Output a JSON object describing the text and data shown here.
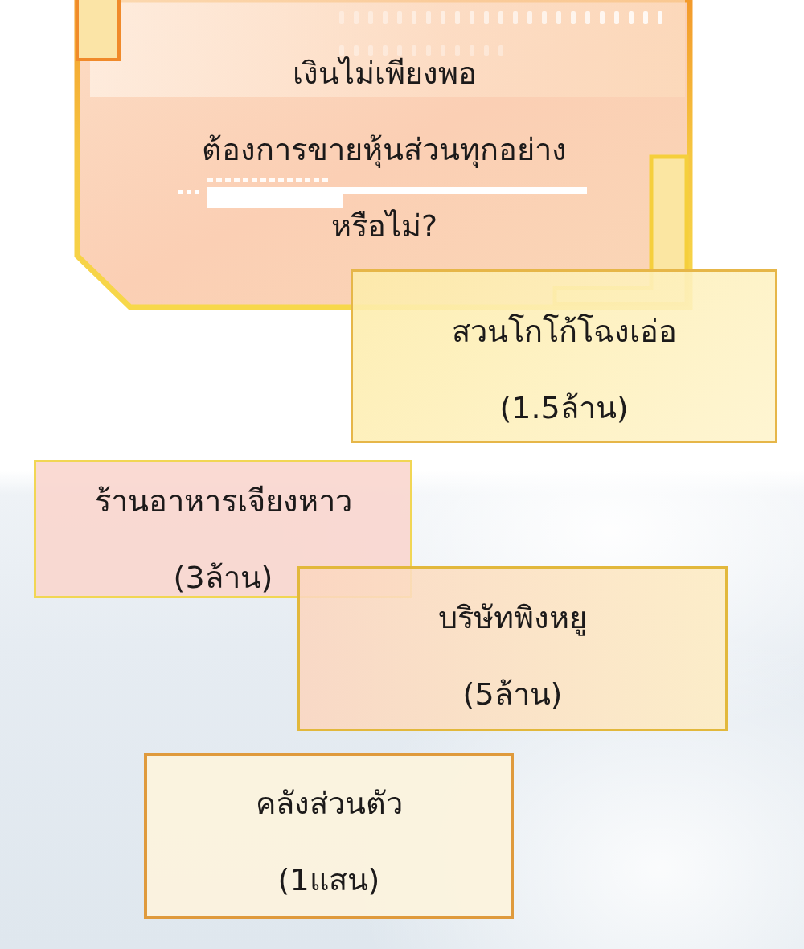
{
  "dialog": {
    "lines": [
      "เงินไม่เพียงพอ",
      "ต้องการขายหุ้นส่วนทุกอย่าง",
      "หรือไม่?"
    ]
  },
  "options": [
    {
      "name": "สวนโกโก้โฉงเอ่อ",
      "price": "(1.5ล้าน)"
    },
    {
      "name": "ร้านอาหารเจียงหาว",
      "price": "(3ล้าน)"
    },
    {
      "name": "บริษัทพิงหยู",
      "price": "(5ล้าน)"
    },
    {
      "name": "คลังส่วนตัว",
      "price": "(1แสน)"
    }
  ]
}
